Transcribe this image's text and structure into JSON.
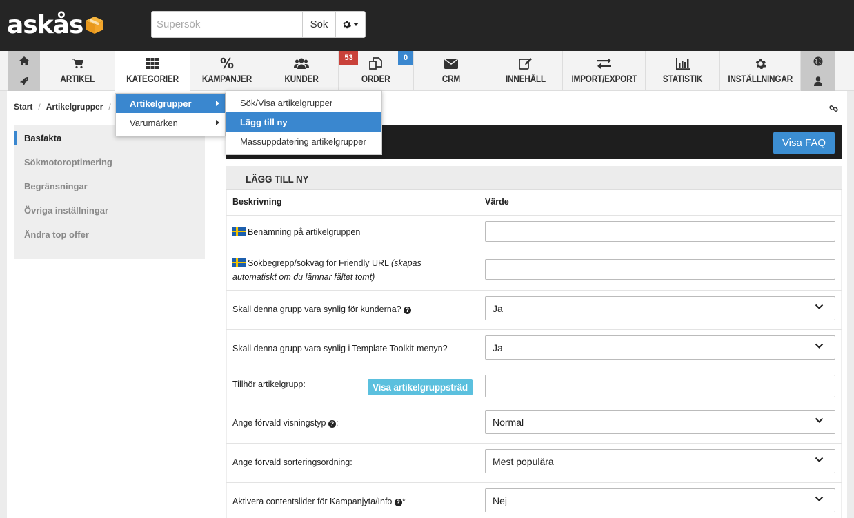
{
  "brand": {
    "logo_text": "askås"
  },
  "search": {
    "placeholder": "Supersök",
    "button_label": "Sök"
  },
  "nav": {
    "items": [
      {
        "label": "ARTIKEL",
        "icon": "cart-icon"
      },
      {
        "label": "KATEGORIER",
        "icon": "grid-icon"
      },
      {
        "label": "KAMPANJER",
        "icon": "percent-icon"
      },
      {
        "label": "KUNDER",
        "icon": "users-icon"
      },
      {
        "label": "ORDER",
        "icon": "copy-icon",
        "badges": [
          "53",
          "0"
        ]
      },
      {
        "label": "CRM",
        "icon": "envelope-icon"
      },
      {
        "label": "INNEHÅLL",
        "icon": "edit-icon"
      },
      {
        "label": "IMPORT/EXPORT",
        "icon": "exchange-icon"
      },
      {
        "label": "STATISTIK",
        "icon": "bar-chart-icon"
      },
      {
        "label": "INSTÄLLNINGAR",
        "icon": "gear-icon"
      }
    ],
    "badge_colors": {
      "order_red": "#c9413a",
      "order_blue": "#3a87cf"
    }
  },
  "menu": {
    "level1": [
      {
        "label": "Artikelgrupper",
        "highlighted": true
      },
      {
        "label": "Varumärken",
        "highlighted": false
      }
    ],
    "level2": [
      {
        "label": "Sök/Visa artikelgrupper",
        "highlighted": false
      },
      {
        "label": "Lägg till ny",
        "highlighted": true
      },
      {
        "label": "Massuppdatering artikelgrupper",
        "highlighted": false
      }
    ]
  },
  "breadcrumb": {
    "items": [
      "Start",
      "Artikelgrupper"
    ]
  },
  "sidebar": {
    "items": [
      {
        "label": "Basfakta",
        "active": true
      },
      {
        "label": "Sökmotoroptimering",
        "active": false
      },
      {
        "label": "Begränsningar",
        "active": false
      },
      {
        "label": "Övriga inställningar",
        "active": false
      },
      {
        "label": "Ändra top offer",
        "active": false
      }
    ]
  },
  "toolbar": {
    "faq_label": "Visa FAQ"
  },
  "form": {
    "title": "LÄGG TILL NY",
    "col_description": "Beskrivning",
    "col_value": "Värde",
    "rows": [
      {
        "label": "Benämning på artikelgruppen",
        "value": ""
      },
      {
        "label_main": "Sökbegrepp/sökväg för Friendly URL ",
        "label_italic": "(skapas automatiskt om du lämnar fältet tomt)",
        "value": ""
      },
      {
        "label": "Skall denna grupp vara synlig för kunderna?",
        "value": "Ja"
      },
      {
        "label": "Skall denna grupp vara synlig i Template Toolkit-menyn?",
        "value": "Ja"
      },
      {
        "label": "Tillhör artikelgrupp:",
        "button": "Visa artikelgruppsträd",
        "value": ""
      },
      {
        "label": "Ange förvald visningstyp",
        "suffix": ":",
        "value": "Normal"
      },
      {
        "label": "Ange förvald sorteringsordning:",
        "value": "Mest populära"
      },
      {
        "label": "Aktivera contentslider för Kampanjyta/Info",
        "suffix": "*",
        "value": "Nej"
      }
    ]
  }
}
